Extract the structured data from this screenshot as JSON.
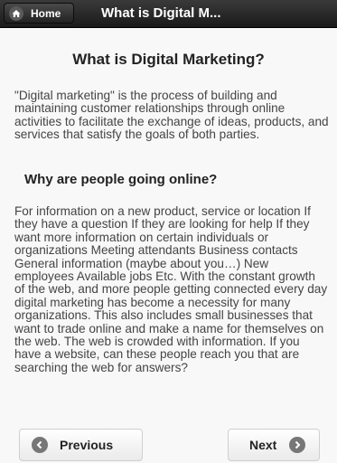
{
  "header": {
    "home_label": "Home",
    "title": "What is Digital M..."
  },
  "main": {
    "title": "What is Digital Marketing?",
    "intro": "\"Digital marketing\" is the process of building and maintaining customer relationships through online activities to facilitate the exchange of ideas, products, and services that satisfy the goals of both parties.",
    "subheading": "Why are people going online?",
    "body": "For information on a new product, service or location If they have a question If they are looking for help If they want more information on certain individuals or organizations Meeting attendants Business contacts General information (maybe about you…) New employees Available jobs Etc. With the constant growth of the web, and more people getting connected every day digital marketing has become a necessity for many organizations. This also includes small businesses that want to trade online and make a name for themselves on the web. The web is crowded with information. If you have a website, can these people reach you that are searching the web for answers?"
  },
  "footer": {
    "previous_label": "Previous",
    "next_label": "Next"
  },
  "icons": {
    "home": "home-icon",
    "previous": "arrow-left-icon",
    "next": "arrow-right-icon"
  }
}
